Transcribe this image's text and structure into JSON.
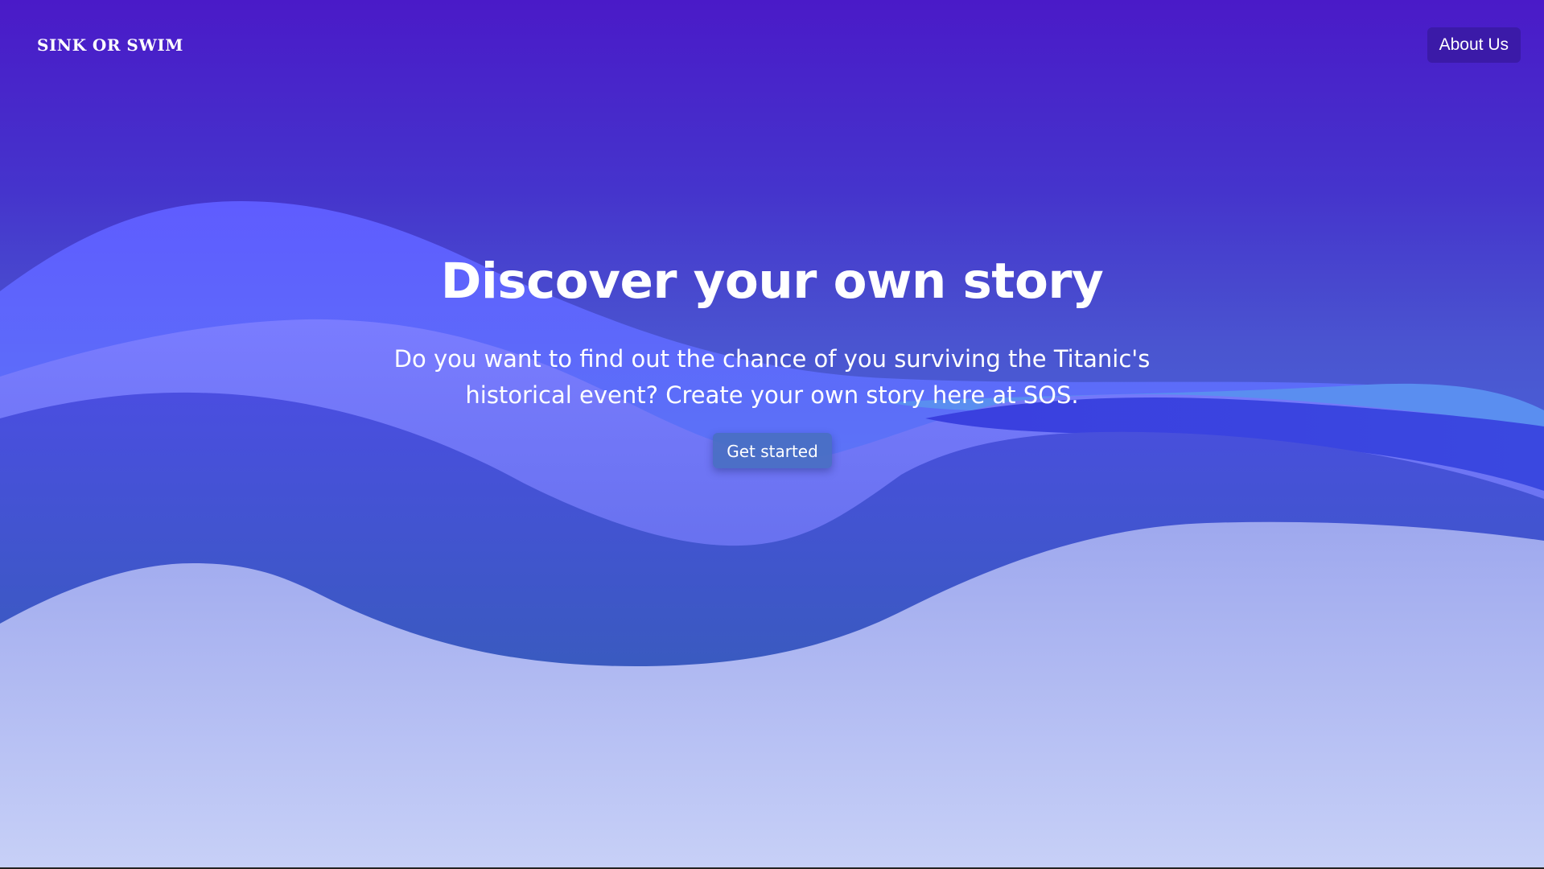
{
  "header": {
    "logo_text": "SINK OR SWIM",
    "about_label": "About Us"
  },
  "hero": {
    "title": "Discover your own story",
    "subtitle": "Do you want to find out the chance of you surviving the Titanic's historical event? Create your own story here at SOS.",
    "cta_label": "Get started"
  },
  "colors": {
    "top_background": "#4a1ac8",
    "about_button": "#3b1aa8",
    "wave_light_blue": "#5b8cf0",
    "wave_violet": "#6f78f5",
    "wave_deep": "#3e47d0",
    "wave_pale": "#a9b4f0"
  }
}
